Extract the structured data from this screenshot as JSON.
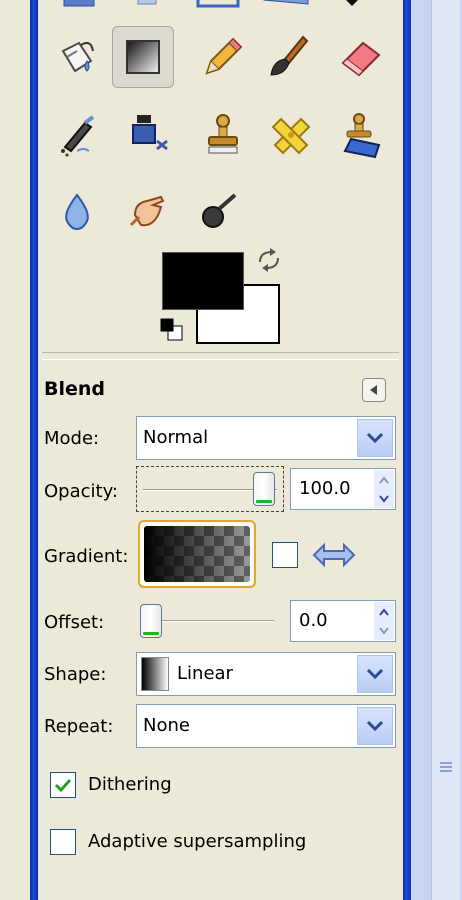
{
  "window": {
    "colors": {
      "frame": "#0a2ea8",
      "panel": "#ece9d8",
      "accent_green": "#24b324"
    }
  },
  "toolbox": {
    "tools": [
      {
        "name": "bucket-fill-tool",
        "icon": "bucket-fill-icon"
      },
      {
        "name": "blend-tool",
        "icon": "gradient-icon",
        "active": true
      },
      {
        "name": "pencil-tool",
        "icon": "pencil-icon"
      },
      {
        "name": "paintbrush-tool",
        "icon": "paintbrush-icon"
      },
      {
        "name": "eraser-tool",
        "icon": "eraser-icon"
      },
      {
        "name": "airbrush-tool",
        "icon": "airbrush-icon"
      },
      {
        "name": "ink-tool",
        "icon": "ink-icon"
      },
      {
        "name": "clone-tool",
        "icon": "clone-stamp-icon"
      },
      {
        "name": "heal-tool",
        "icon": "bandage-icon"
      },
      {
        "name": "perspective-clone-tool",
        "icon": "perspective-clone-icon"
      },
      {
        "name": "blur-sharpen-tool",
        "icon": "water-drop-icon"
      },
      {
        "name": "smudge-tool",
        "icon": "smudge-hand-icon"
      },
      {
        "name": "dodge-burn-tool",
        "icon": "dodge-burn-icon"
      }
    ],
    "foreground_color": "#000000",
    "background_color": "#ffffff"
  },
  "tool_options": {
    "title": "Blend",
    "mode": {
      "label": "Mode:",
      "value": "Normal"
    },
    "opacity": {
      "label": "Opacity:",
      "value": "100.0",
      "fraction": 1.0
    },
    "gradient": {
      "label": "Gradient:"
    },
    "offset": {
      "label": "Offset:",
      "value": "0.0",
      "fraction": 0.0
    },
    "shape": {
      "label": "Shape:",
      "value": "Linear"
    },
    "repeat": {
      "label": "Repeat:",
      "value": "None"
    },
    "dithering": {
      "label": "Dithering",
      "checked": true
    },
    "adaptive": {
      "label": "Adaptive supersampling",
      "checked": false
    }
  }
}
